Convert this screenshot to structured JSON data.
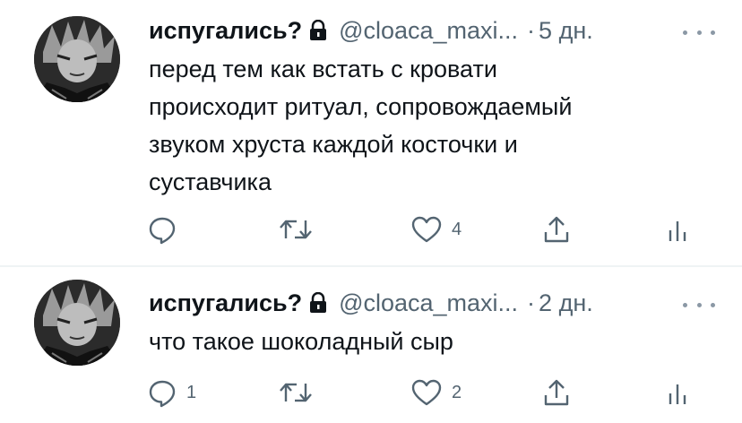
{
  "tweets": [
    {
      "author_name": "испугались?",
      "handle": "@cloaca_maxi...",
      "separator": "·",
      "time": "5 дн.",
      "text": "перед тем как встать с кровати\nпроисходит ритуал, сопровождаемый\nзвуком хруста каждой косточки и\nсуставчика",
      "reply_count": "",
      "retweet_count": "",
      "like_count": "4"
    },
    {
      "author_name": "испугались?",
      "handle": "@cloaca_maxi...",
      "separator": "·",
      "time": "2 дн.",
      "text": "что такое шоколадный сыр",
      "reply_count": "1",
      "retweet_count": "",
      "like_count": "2"
    }
  ],
  "icons": {
    "lock": "lock-icon",
    "more": "more-icon",
    "reply": "reply-icon",
    "retweet": "retweet-icon",
    "like": "heart-icon",
    "share": "share-icon",
    "stats": "stats-icon"
  },
  "colors": {
    "text": "#0f1419",
    "secondary": "#536471",
    "divider": "#eff3f4"
  }
}
